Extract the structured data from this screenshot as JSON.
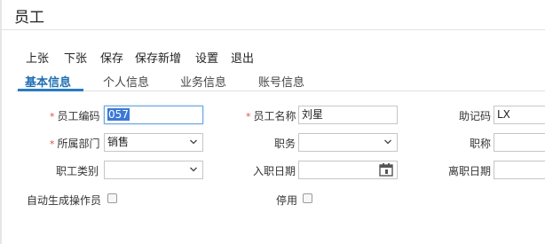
{
  "window": {
    "title": "员工"
  },
  "toolbar": {
    "items": [
      "上张",
      "下张",
      "保存",
      "保存新增",
      "设置",
      "退出"
    ]
  },
  "tabs": [
    {
      "label": "基本信息",
      "active": true
    },
    {
      "label": "个人信息",
      "active": false
    },
    {
      "label": "业务信息",
      "active": false
    },
    {
      "label": "账号信息",
      "active": false
    }
  ],
  "form": {
    "employee_code": {
      "label": "员工编码",
      "required": true,
      "value": "057"
    },
    "employee_name": {
      "label": "员工名称",
      "required": true,
      "value": "刘星"
    },
    "mnemonic_code": {
      "label": "助记码",
      "value": "LX"
    },
    "department": {
      "label": "所属部门",
      "required": true,
      "value": "销售"
    },
    "position": {
      "label": "职务",
      "value": ""
    },
    "title": {
      "label": "职称",
      "value": ""
    },
    "employee_type": {
      "label": "职工类别",
      "value": ""
    },
    "hire_date": {
      "label": "入职日期",
      "value": ""
    },
    "leave_date": {
      "label": "离职日期",
      "value": ""
    },
    "auto_create_operator": {
      "label": "自动生成操作员",
      "checked": false
    },
    "disabled": {
      "label": "停用",
      "checked": false
    }
  },
  "colors": {
    "accent": "#2b7bc2",
    "required_mark": "#d9534f"
  }
}
